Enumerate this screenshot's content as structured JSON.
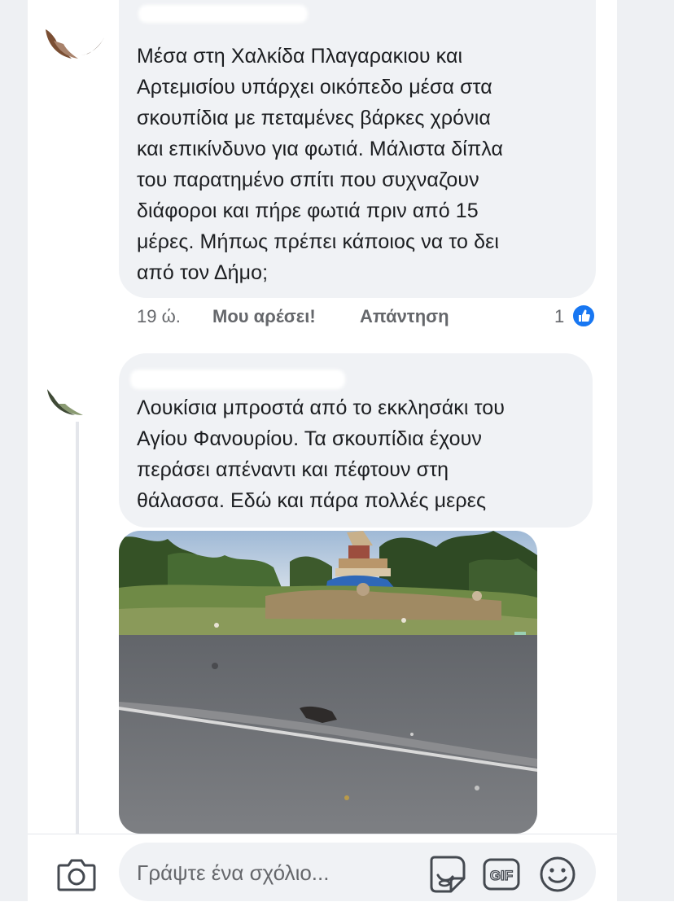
{
  "comments": [
    {
      "text_lines": [
        "Μέσα στη Χαλκίδα Πλαγαρακιου και",
        "Αρτεμισίου υπάρχει οικόπεδο μέσα στα",
        "σκουπίδια με πεταμένες βάρκες χρόνια",
        "και επικίνδυνο για φωτιά. Μάλιστα δίπλα",
        "του παρατημένο σπίτι που συχναζουν",
        "διάφοροι και πήρε φωτιά πριν από 15",
        "μέρες. Μήπως πρέπει κάποιος να το δει",
        "από τον Δήμο;"
      ],
      "time": "19 ώ.",
      "like_label": "Μου αρέσει!",
      "reply_label": "Απάντηση",
      "reaction_count": "1",
      "reaction_icon": "thumbs-up-icon"
    },
    {
      "text_lines": [
        "Λουκίσια μπροστά από το εκκλησάκι του",
        "Αγίου Φανουρίου.  Τα σκουπίδια έχουν",
        "περάσει απέναντι και πέφτουν στη",
        "θάλασσα. Εδώ και πάρα πολλές μερες"
      ],
      "has_photo": true
    }
  ],
  "composer": {
    "placeholder": "Γράψτε ένα σχόλιο...",
    "camera_icon": "camera-icon",
    "sticker_icon": "sticker-icon",
    "gif_label": "GIF",
    "emoji_icon": "emoji-icon"
  },
  "colors": {
    "bubble": "#f0f2f5",
    "text": "#1c1e21",
    "secondary_text": "#65676b",
    "like_blue": "#1877f2"
  }
}
